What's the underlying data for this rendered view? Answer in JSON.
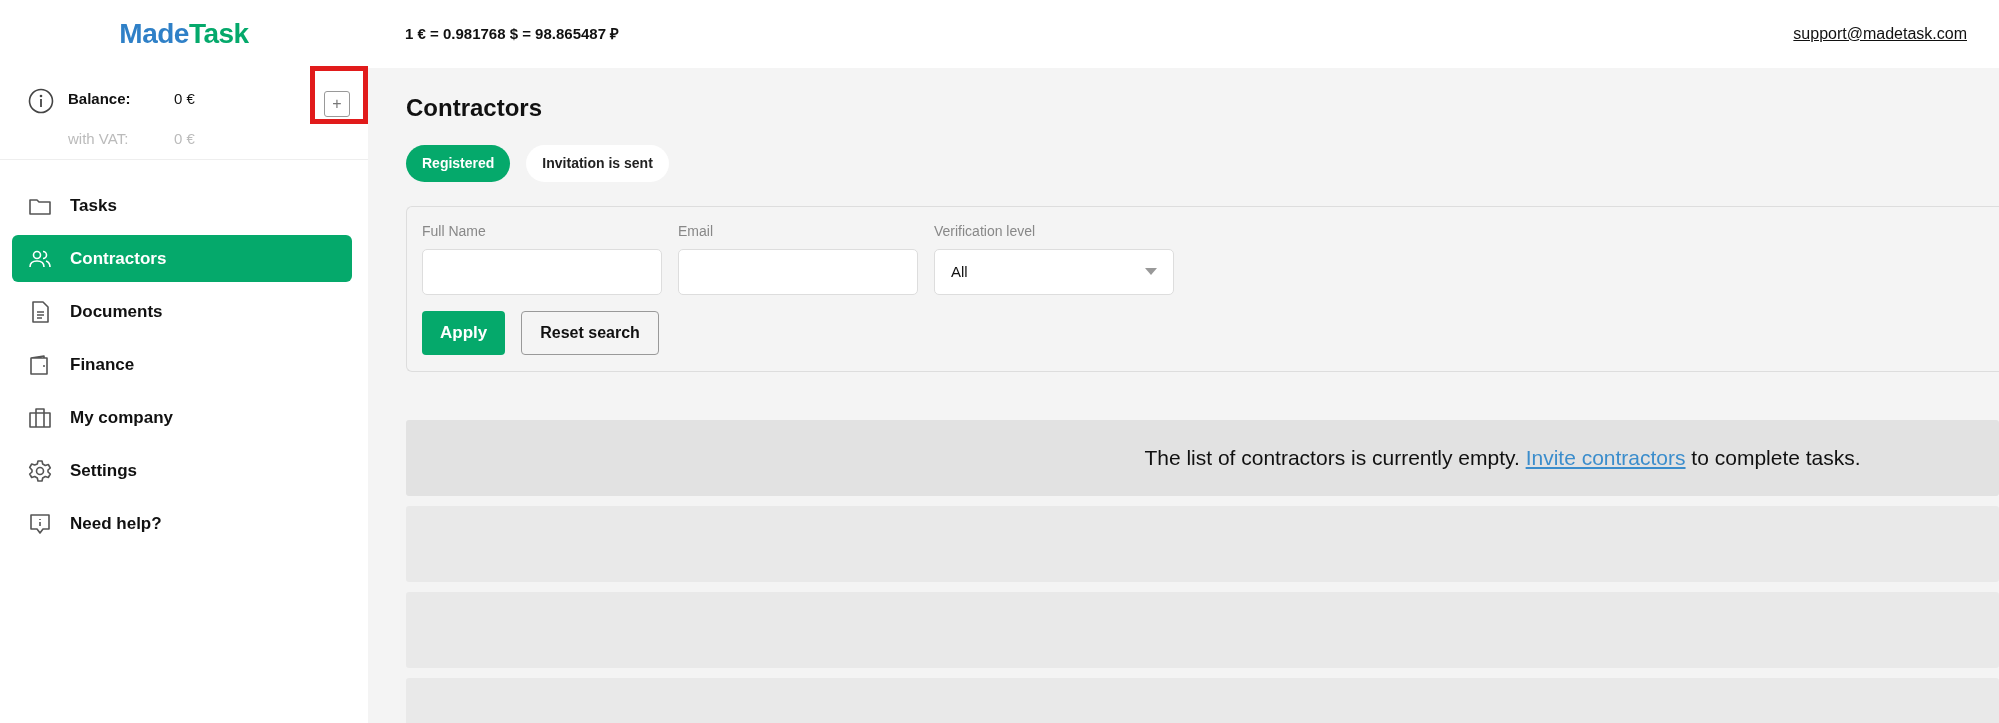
{
  "logo": {
    "first": "Made",
    "second": "Task"
  },
  "header": {
    "rates": "1 € = 0.981768 $ = 98.865487 ₽",
    "support_email": "support@madetask.com"
  },
  "balance": {
    "label": "Balance:",
    "value": "0 €",
    "vat_label": "with VAT:",
    "vat_value": "0 €",
    "add_button": {
      "label": "+",
      "highlighted": true
    }
  },
  "sidebar": {
    "items": [
      {
        "label": "Tasks",
        "kind": "folder",
        "selected": false
      },
      {
        "label": "Contractors",
        "kind": "users",
        "selected": true
      },
      {
        "label": "Documents",
        "kind": "document",
        "selected": false
      },
      {
        "label": "Finance",
        "kind": "wallet",
        "selected": false
      },
      {
        "label": "My company",
        "kind": "briefcase",
        "selected": false
      },
      {
        "label": "Settings",
        "kind": "gear",
        "selected": false
      },
      {
        "label": "Need help?",
        "kind": "help",
        "selected": false
      }
    ]
  },
  "page": {
    "title": "Contractors",
    "tabs": [
      {
        "label": "Registered",
        "selected": true
      },
      {
        "label": "Invitation is sent",
        "selected": false
      }
    ],
    "filters": {
      "fields": [
        {
          "label": "Full Name",
          "kind": "text"
        },
        {
          "label": "Email",
          "kind": "text"
        },
        {
          "label": "Verification level",
          "kind": "select",
          "value": "All"
        }
      ],
      "apply": "Apply",
      "reset": "Reset search"
    },
    "empty_message": {
      "before": "The list of contractors is currently empty.",
      "link": "Invite contractors",
      "after": "to complete tasks."
    }
  }
}
